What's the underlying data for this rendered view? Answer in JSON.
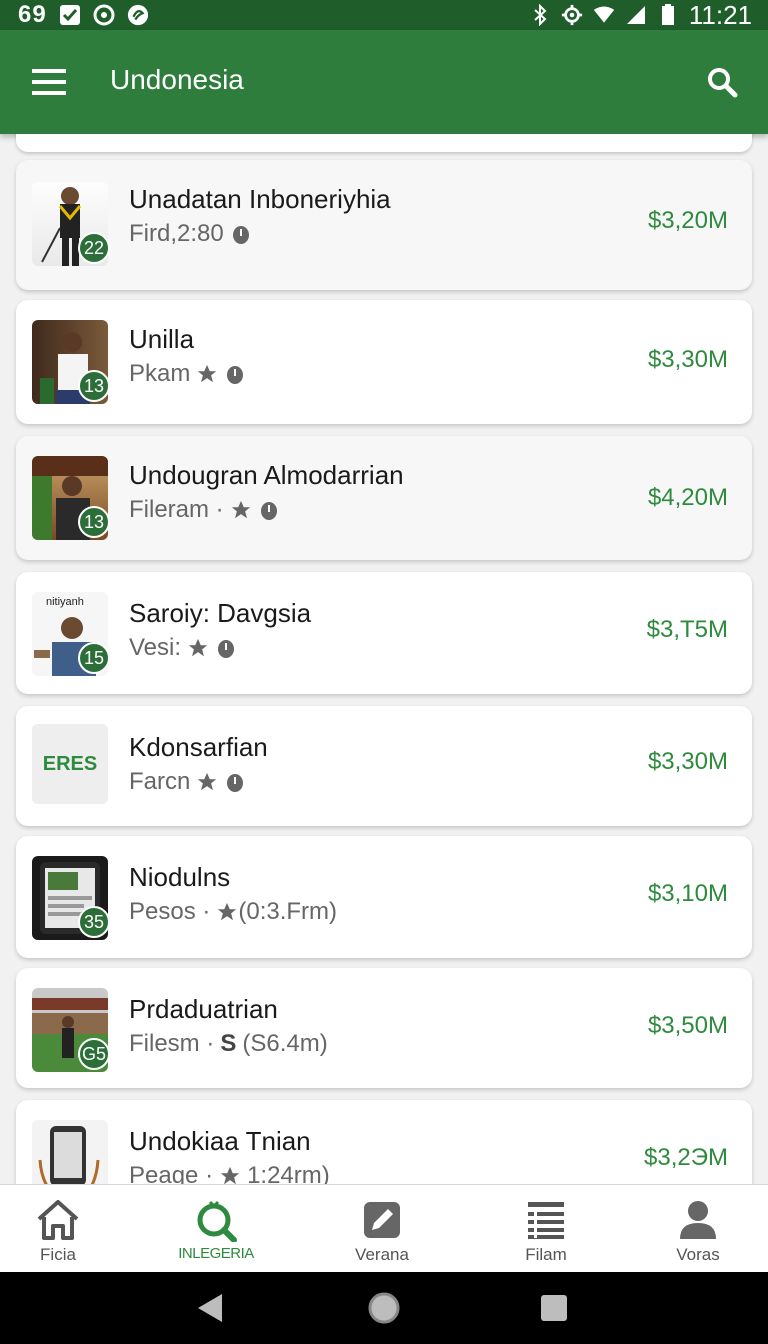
{
  "status_bar": {
    "left_text": "69",
    "time": "11:21"
  },
  "app_bar": {
    "title": "Undonesia"
  },
  "items": [
    {
      "title": "Unadatan Inboneriyhia",
      "subtitle": "Fird,2:80",
      "price": "$3,20M",
      "badge": "22",
      "thumb": "person"
    },
    {
      "title": "Unilla",
      "subtitle": "Pkam",
      "price": "$3,30M",
      "badge": "13",
      "thumb": "person"
    },
    {
      "title": "Undougran Almodarrian",
      "subtitle": "Fileram ·",
      "price": "$4,20M",
      "badge": "13",
      "thumb": "person"
    },
    {
      "title": "Saroiy: Davgsia",
      "subtitle": "Vesi:",
      "price": "$3,T5M",
      "badge": "15",
      "thumb": "person",
      "thumb_caption": "nitiyanh"
    },
    {
      "title": "Kdonsarfian",
      "subtitle": "Farcn",
      "price": "$3,30M",
      "badge": "",
      "thumb": "logo",
      "thumb_logo": "ERES"
    },
    {
      "title": "Niodulns",
      "subtitle": "Pesos ·",
      "subtitle_extra": "(0:3.Frm)",
      "price": "$3,10M",
      "badge": "35",
      "thumb": "phone"
    },
    {
      "title": "Prdaduatrian",
      "subtitle": "Filesm ·",
      "subtitle_s": "S",
      "subtitle_extra": "(S6.4m)",
      "price": "$3,50M",
      "badge": "G5",
      "thumb": "building"
    },
    {
      "title": "Undokiaa Tnian",
      "subtitle": "Peage ·",
      "subtitle_extra": "1:24rm)",
      "price": "$3,2ЭM",
      "badge": "",
      "thumb": "phone"
    }
  ],
  "bottom_nav": [
    {
      "label": "Ficia",
      "icon": "home-icon",
      "active": false
    },
    {
      "label": "INLEGERIA",
      "icon": "search-location-icon",
      "active": true
    },
    {
      "label": "Verana",
      "icon": "edit-icon",
      "active": false
    },
    {
      "label": "Filam",
      "icon": "list-icon",
      "active": false
    },
    {
      "label": "Voras",
      "icon": "person-icon",
      "active": false
    }
  ],
  "colors": {
    "appbar": "#2f7d3d",
    "statusbar": "#1f5e2b",
    "price": "#2e8a3e",
    "active_nav": "#2e8a3e"
  }
}
